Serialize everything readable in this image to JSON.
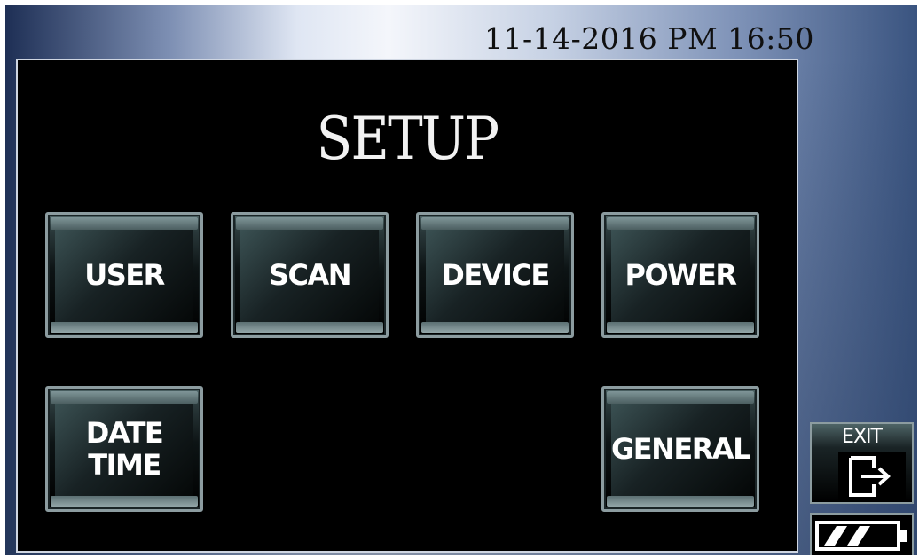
{
  "status_bar": {
    "datetime": "11-14-2016 PM 16:50"
  },
  "screen": {
    "title": "SETUP"
  },
  "menu_buttons": [
    {
      "id": "user",
      "label": "USER"
    },
    {
      "id": "scan",
      "label": "SCAN"
    },
    {
      "id": "device",
      "label": "DEVICE"
    },
    {
      "id": "power",
      "label": "POWER"
    },
    {
      "id": "date_time",
      "label": "DATE\nTIME"
    },
    {
      "id": "general",
      "label": "GENERAL"
    }
  ],
  "side_panel": {
    "exit_label": "EXIT",
    "exit_icon": "exit-door-arrow-icon",
    "battery_icon": "battery-icon",
    "battery_level": 0.67
  },
  "colors": {
    "screen_background": "#000000",
    "button_text": "#ffffff",
    "title_text": "#f2f2f2"
  }
}
